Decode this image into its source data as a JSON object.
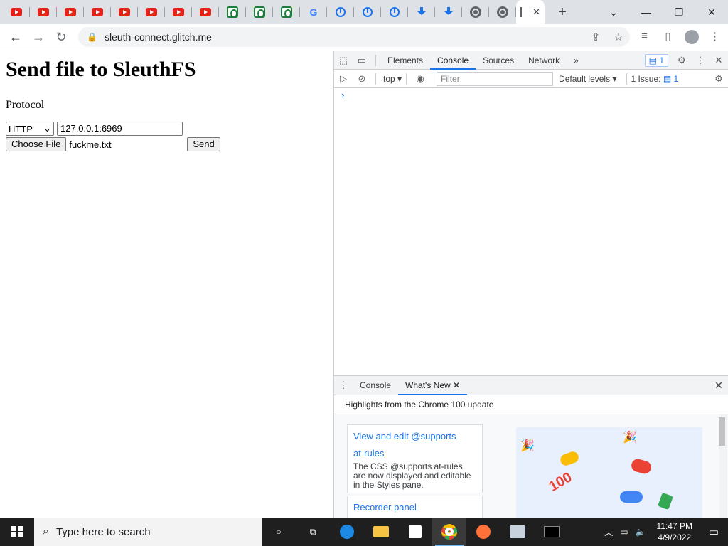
{
  "browser": {
    "url": "sleuth-connect.glitch.me",
    "window_controls": {
      "chevron": "⌄",
      "minimize": "—",
      "restore": "❐",
      "close": "✕"
    },
    "new_tab": "+",
    "active_tab_close": "✕",
    "tab_favicons": [
      "youtube",
      "youtube",
      "youtube",
      "youtube",
      "youtube",
      "youtube",
      "youtube",
      "youtube",
      "glitch",
      "glitch",
      "glitch",
      "google",
      "history",
      "history",
      "history",
      "download",
      "download",
      "chrome",
      "chrome"
    ]
  },
  "page": {
    "heading": "Send file to SleuthFS",
    "protocol_label": "Protocol",
    "protocol_value": "HTTP",
    "address_value": "127.0.0.1:6969",
    "choose_file_label": "Choose File",
    "file_name": "fuckme.txt",
    "send_label": "Send"
  },
  "devtools": {
    "tabs": [
      "Elements",
      "Console",
      "Sources",
      "Network"
    ],
    "active_tab": "Console",
    "more": "»",
    "message_badge": "1",
    "context": "top",
    "filter_placeholder": "Filter",
    "levels": "Default levels",
    "issues_label": "1 Issue:",
    "issues_count": "1",
    "prompt": "›",
    "drawer": {
      "tabs": [
        "Console",
        "What's New"
      ],
      "active_tab": "What's New",
      "highlights": "Highlights from the Chrome 100 update",
      "card1_title_1": "View and edit @supports",
      "card1_title_2": "at-rules",
      "card1_desc": "The CSS @supports at-rules are now displayed and editable in the Styles pane.",
      "card2_title": "Recorder panel",
      "promo_badge": "100"
    }
  },
  "taskbar": {
    "search_placeholder": "Type here to search",
    "time": "11:47 PM",
    "date": "4/9/2022",
    "apps": [
      "task-view",
      "edge",
      "file-explorer",
      "store",
      "chrome",
      "firefox",
      "unknown-app",
      "terminal"
    ]
  },
  "colors": {
    "accent": "#1a73e8",
    "youtube": "#e62117",
    "glitch": "#1b7f3b",
    "taskbar": "#1f1f1f"
  }
}
